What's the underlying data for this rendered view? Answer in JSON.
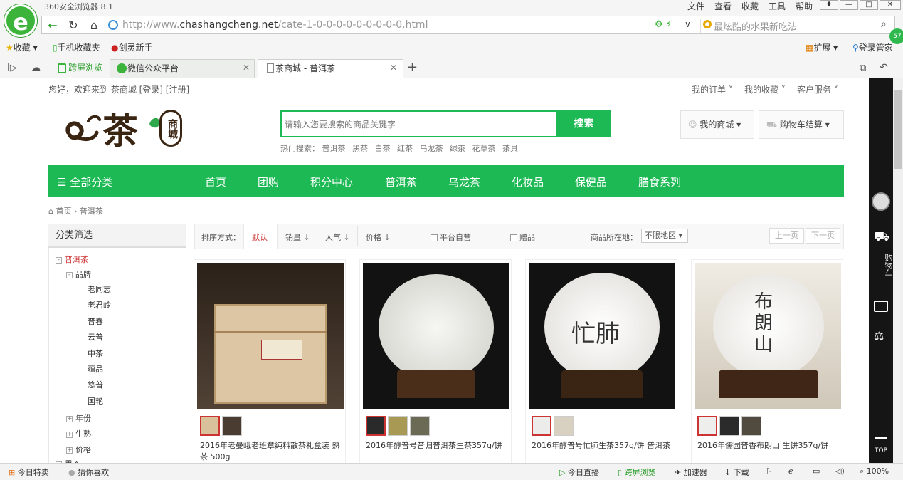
{
  "browser": {
    "title": "360安全浏览器 8.1",
    "menu": [
      "文件",
      "查看",
      "收藏",
      "工具",
      "帮助"
    ],
    "url_domain": "chashangcheng.net",
    "url_prefix": "http://www.",
    "url_path": "/cate-1-0-0-0-0-0-0-0-0-0.html",
    "search_hint": "最炫酷的水果新吃法",
    "bookmarks": [
      "收藏",
      "手机收藏夹",
      "剑灵新手"
    ],
    "ext_label": "扩展",
    "login_label": "登录管家",
    "tabs": [
      {
        "label": "跨屏浏览"
      },
      {
        "label": "微信公众平台"
      },
      {
        "label": "茶商城 - 普洱茶"
      }
    ]
  },
  "site": {
    "welcome": "您好，欢迎来到 茶商城 [登录] [注册]",
    "top_links": [
      "我的订单",
      "我的收藏",
      "客户服务"
    ],
    "logo_text": "茶",
    "logo_badge": "商城",
    "search_placeholder": "请输入您要搜索的商品关键字",
    "search_button": "搜索",
    "hot_label": "热门搜索：",
    "hot_terms": [
      "普洱茶",
      "黑茶",
      "白茶",
      "红茶",
      "乌龙茶",
      "绿茶",
      "花草茶",
      "茶具"
    ],
    "my_mall": "我的商城",
    "cart": "购物车结算",
    "all_categories": "全部分类",
    "nav": [
      "首页",
      "团购",
      "积分中心",
      "普洱茶",
      "乌龙茶",
      "化妆品",
      "保健品",
      "膳食系列"
    ],
    "breadcrumb_home": "首页",
    "breadcrumb_current": "普洱茶"
  },
  "sidebar": {
    "title": "分类筛选",
    "root": "普洱茶",
    "brand_group": "品牌",
    "brands": [
      "老同志",
      "老君岭",
      "普春",
      "云普",
      "中茶",
      "蕴品",
      "悠普",
      "国艳"
    ],
    "groups": [
      "年份",
      "生熟",
      "价格"
    ],
    "next_root": "黑茶"
  },
  "sortbar": {
    "label": "排序方式：",
    "options": [
      "默认",
      "销量",
      "人气",
      "价格"
    ],
    "self_op": "平台自营",
    "gift": "赠品",
    "location_label": "商品所在地：",
    "location_value": "不限地区",
    "prev": "上一页",
    "next": "下一页"
  },
  "products": [
    {
      "name": "2016年老曼峨老班章纯料散茶礼盒装 熟茶 500g"
    },
    {
      "name": "2016年醇普号昔归普洱茶生茶357g/饼"
    },
    {
      "name": "2016年醇普号忙肺生茶357g/饼 普洱茶"
    },
    {
      "name": "2016年儒园普香布朗山 生饼357g/饼"
    }
  ],
  "rail": {
    "cart": "购物车",
    "top": "TOP"
  },
  "status": {
    "left": [
      "今日特卖",
      "猜你喜欢"
    ],
    "right": [
      "今日直播",
      "跨屏浏览",
      "加速器",
      "下载"
    ],
    "zoom": "100%"
  },
  "colors": {
    "brand_green": "#1db954",
    "accent_red": "#cc3333"
  }
}
